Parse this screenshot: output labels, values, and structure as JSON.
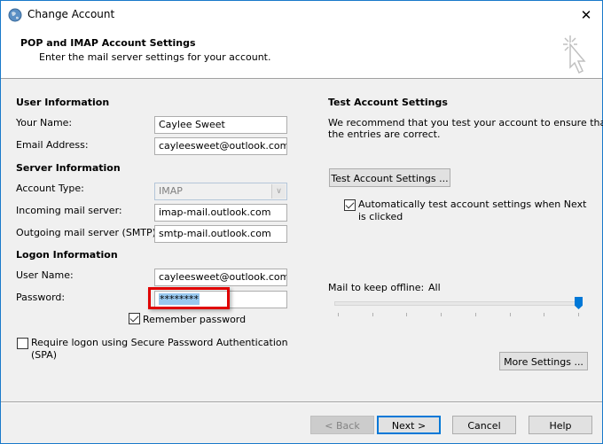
{
  "window": {
    "title": "Change Account",
    "close_label": "✕"
  },
  "header": {
    "title": "POP and IMAP Account Settings",
    "subtitle": "Enter the mail server settings for your account."
  },
  "user_info": {
    "section": "User Information",
    "name_label": "Your Name:",
    "name_value": "Caylee Sweet",
    "email_label": "Email Address:",
    "email_value": "cayleesweet@outlook.com"
  },
  "server_info": {
    "section": "Server Information",
    "account_type_label": "Account Type:",
    "account_type_value": "IMAP",
    "incoming_label": "Incoming mail server:",
    "incoming_value": "imap-mail.outlook.com",
    "outgoing_label": "Outgoing mail server (SMTP):",
    "outgoing_value": "smtp-mail.outlook.com"
  },
  "logon_info": {
    "section": "Logon Information",
    "username_label": "User Name:",
    "username_value": "cayleesweet@outlook.com",
    "password_label": "Password:",
    "password_value": "********",
    "remember_label": "Remember password",
    "remember_checked": true,
    "spa_label_line1": "Require logon using Secure Password Authentication",
    "spa_label_line2": "(SPA)",
    "spa_checked": false
  },
  "test_settings": {
    "section": "Test Account Settings",
    "desc_line1": "We recommend that you test your account to ensure that",
    "desc_line2": "the entries are correct.",
    "test_button": "Test Account Settings ...",
    "auto_test_line1": "Automatically test account settings when Next",
    "auto_test_line2": "is clicked",
    "auto_test_checked": true
  },
  "offline": {
    "label": "Mail to keep offline:",
    "value": "All",
    "slider_position": 1.0,
    "slider_steps": 8
  },
  "more_settings_button": "More Settings ...",
  "footer": {
    "back": "< Back",
    "next": "Next >",
    "cancel": "Cancel",
    "help": "Help"
  },
  "colors": {
    "accent": "#0078d7",
    "highlight": "#e00000",
    "selection": "#99c9ef"
  }
}
